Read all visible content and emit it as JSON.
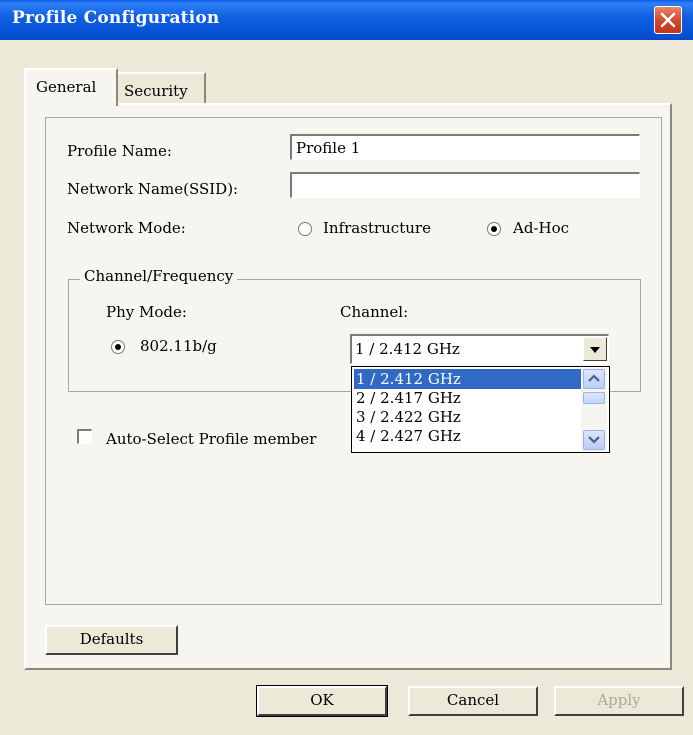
{
  "window": {
    "title": "Profile Configuration"
  },
  "tabs": [
    {
      "label": "General",
      "active": true
    },
    {
      "label": "Security",
      "active": false
    }
  ],
  "fields": {
    "profile_name_label": "Profile Name:",
    "profile_name_value": "Profile 1",
    "ssid_label": "Network Name(SSID):",
    "ssid_value": "",
    "network_mode_label": "Network Mode:",
    "mode_infrastructure": "Infrastructure",
    "mode_adhoc": "Ad-Hoc",
    "selected_mode": "Ad-Hoc"
  },
  "channel_group": {
    "title": "Channel/Frequency",
    "phy_mode_label": "Phy Mode:",
    "phy_mode_value": "802.11b/g",
    "channel_label": "Channel:",
    "channel_selected": "1 / 2.412 GHz",
    "channel_options": [
      "1 / 2.412 GHz",
      "2 / 2.417 GHz",
      "3 / 2.422 GHz",
      "4 / 2.427 GHz"
    ]
  },
  "auto_select": {
    "label": "Auto-Select Profile member",
    "checked": false
  },
  "buttons": {
    "defaults": "Defaults",
    "ok": "OK",
    "cancel": "Cancel",
    "apply": "Apply"
  },
  "colors": {
    "titlebar": "#0a5ae8",
    "close": "#d1442a",
    "selection": "#316ac5",
    "window_bg": "#ece9d8"
  },
  "icons": {
    "close": "close-icon",
    "dropdown": "chevron-down-icon",
    "scroll_up": "chevron-up-icon",
    "scroll_down": "chevron-down-icon"
  }
}
